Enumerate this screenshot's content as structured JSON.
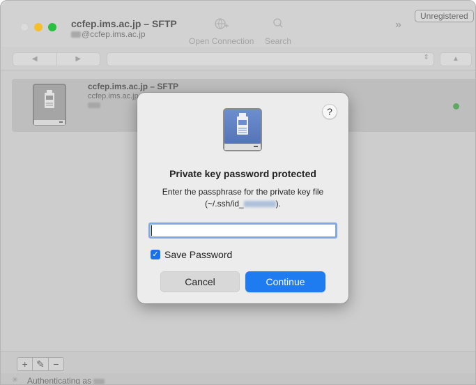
{
  "window": {
    "title": "ccfep.ims.ac.jp – SFTP",
    "subtitle": "@ccfep.ims.ac.jp",
    "unregistered": "Unregistered"
  },
  "toolbar": {
    "open_connection": "Open Connection",
    "search": "Search",
    "open_connection_icon": "globe-plus-icon",
    "search_icon": "search-icon",
    "overflow_icon": "chevron-double-right-icon"
  },
  "nav": {
    "back_icon": "triangle-left-icon",
    "forward_icon": "triangle-right-icon",
    "up_icon": "triangle-up-icon"
  },
  "bookmark": {
    "title": "ccfep.ims.ac.jp – SFTP",
    "host": "ccfep.ims.ac.jp",
    "status_color": "#5ea863"
  },
  "bottom": {
    "add": "+",
    "edit": "✎",
    "remove": "−"
  },
  "status": {
    "text": "Authenticating as"
  },
  "dialog": {
    "help": "?",
    "title": "Private key password protected",
    "message_line1": "Enter the passphrase for the private key file",
    "message_prefix": "(~/.ssh/id_",
    "message_suffix": ").",
    "password_value": "",
    "save_password_label": "Save Password",
    "save_password_checked": true,
    "cancel_label": "Cancel",
    "continue_label": "Continue",
    "accent_color": "#1e7bf0"
  }
}
